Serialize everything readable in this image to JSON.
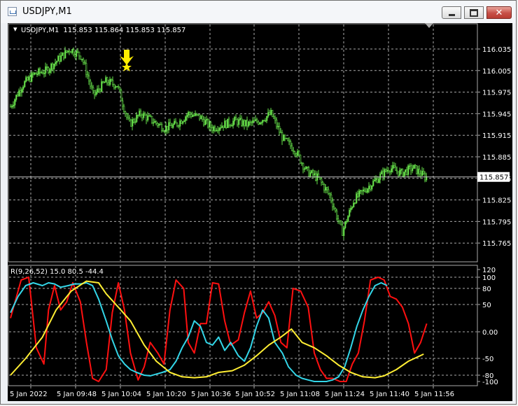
{
  "window": {
    "title": "USDJPY,M1",
    "icon": "chart-window-icon",
    "buttons": {
      "minimize": "minimize-icon",
      "maximize": "maximize-icon",
      "close": "close-icon"
    }
  },
  "colors": {
    "background": "#000000",
    "grid": "#aaaaaa",
    "candles": "#66e04a",
    "current_price_line": "#c0c0c0",
    "marker": "#ffee00",
    "rsi_like": "#ff1010",
    "cyan_line": "#33d6e8",
    "yellow_line": "#ffee33"
  },
  "chart_data": [
    {
      "type": "candlestick",
      "title": "USDJPY,M1",
      "ohlc_header": "115.853 115.864 115.853 115.857",
      "symbol_label": "USDJPY,M1",
      "ylim": [
        115.755,
        116.055
      ],
      "y_ticks": [
        "116.035",
        "116.005",
        "115.975",
        "115.945",
        "115.915",
        "115.885",
        "115.855",
        "115.825",
        "115.795",
        "115.765"
      ],
      "current_price": 115.857,
      "current_price_label": "115.857",
      "grid": true,
      "marker": {
        "type": "arrow-down-with-star",
        "x": "5 Jan 10:04",
        "price": 116.005
      },
      "close_trace": [
        [
          "5 Jan 2022",
          115.955
        ],
        [
          "5 Jan 09:38",
          115.985
        ],
        [
          "5 Jan 09:43",
          116.0
        ],
        [
          "5 Jan 09:46",
          116.005
        ],
        [
          "5 Jan 09:48",
          116.02
        ],
        [
          "5 Jan 09:52",
          116.035
        ],
        [
          "5 Jan 09:56",
          116.025
        ],
        [
          "5 Jan 10:00",
          115.97
        ],
        [
          "5 Jan 10:04",
          115.99
        ],
        [
          "5 Jan 10:06",
          115.985
        ],
        [
          "5 Jan 10:10",
          115.93
        ],
        [
          "5 Jan 10:14",
          115.945
        ],
        [
          "5 Jan 10:18",
          115.935
        ],
        [
          "5 Jan 10:22",
          115.925
        ],
        [
          "5 Jan 10:26",
          115.93
        ],
        [
          "5 Jan 10:30",
          115.945
        ],
        [
          "5 Jan 10:36",
          115.94
        ],
        [
          "5 Jan 10:40",
          115.925
        ],
        [
          "5 Jan 10:44",
          115.93
        ],
        [
          "5 Jan 10:50",
          115.935
        ],
        [
          "5 Jan 10:56",
          115.93
        ],
        [
          "5 Jan 11:00",
          115.935
        ],
        [
          "5 Jan 11:04",
          115.945
        ],
        [
          "5 Jan 11:08",
          115.91
        ],
        [
          "5 Jan 11:12",
          115.895
        ],
        [
          "5 Jan 11:16",
          115.865
        ],
        [
          "5 Jan 11:20",
          115.855
        ],
        [
          "5 Jan 11:24",
          115.83
        ],
        [
          "5 Jan 11:27",
          115.78
        ],
        [
          "5 Jan 11:30",
          115.825
        ],
        [
          "5 Jan 11:34",
          115.84
        ],
        [
          "5 Jan 11:38",
          115.855
        ],
        [
          "5 Jan 11:42",
          115.87
        ],
        [
          "5 Jan 11:46",
          115.862
        ],
        [
          "5 Jan 11:50",
          115.87
        ],
        [
          "5 Jan 11:52",
          115.857
        ]
      ]
    },
    {
      "type": "line",
      "title": "R(9,26,52) 15.0 80.5 -44.4",
      "ylim": [
        -110,
        120
      ],
      "y_ticks": [
        "120",
        "100",
        "80",
        "50",
        "0.00",
        "-50",
        "-80",
        "-100"
      ],
      "levels": [
        80,
        50,
        -50,
        -80
      ],
      "grid": true,
      "x_labels": [
        "5 Jan 2022",
        "5 Jan 09:48",
        "5 Jan 10:04",
        "5 Jan 10:20",
        "5 Jan 10:36",
        "5 Jan 10:52",
        "5 Jan 11:08",
        "5 Jan 11:24",
        "5 Jan 11:40",
        "5 Jan 11:56"
      ],
      "series": [
        {
          "color": "#ff1010",
          "points": [
            [
              0,
              25
            ],
            [
              7,
              95
            ],
            [
              12,
              100
            ],
            [
              17,
              -30
            ],
            [
              22,
              -60
            ],
            [
              25,
              40
            ],
            [
              29,
              85
            ],
            [
              33,
              40
            ],
            [
              37,
              55
            ],
            [
              41,
              90
            ],
            [
              46,
              55
            ],
            [
              50,
              -20
            ],
            [
              54,
              -90
            ],
            [
              58,
              -100
            ],
            [
              63,
              -70
            ],
            [
              67,
              35
            ],
            [
              71,
              90
            ],
            [
              75,
              40
            ],
            [
              79,
              -40
            ],
            [
              84,
              -95
            ],
            [
              88,
              -65
            ],
            [
              92,
              -20
            ],
            [
              97,
              -40
            ],
            [
              101,
              -60
            ],
            [
              105,
              40
            ],
            [
              109,
              95
            ],
            [
              114,
              80
            ],
            [
              117,
              -20
            ],
            [
              121,
              -40
            ],
            [
              125,
              15
            ],
            [
              129,
              15
            ],
            [
              133,
              90
            ],
            [
              137,
              88
            ],
            [
              141,
              20
            ],
            [
              145,
              -25
            ],
            [
              150,
              -15
            ],
            [
              154,
              35
            ],
            [
              158,
              75
            ],
            [
              162,
              25
            ],
            [
              166,
              35
            ],
            [
              170,
              55
            ],
            [
              174,
              30
            ],
            [
              178,
              -20
            ],
            [
              182,
              -30
            ],
            [
              186,
              80
            ],
            [
              191,
              75
            ],
            [
              196,
              45
            ],
            [
              200,
              -40
            ],
            [
              204,
              -70
            ],
            [
              208,
              -90
            ],
            [
              212,
              -90
            ],
            [
              217,
              -100
            ],
            [
              221,
              -100
            ],
            [
              225,
              -60
            ],
            [
              229,
              -40
            ],
            [
              233,
              20
            ],
            [
              237,
              95
            ],
            [
              242,
              100
            ],
            [
              246,
              95
            ],
            [
              250,
              65
            ],
            [
              254,
              60
            ],
            [
              258,
              45
            ],
            [
              262,
              15
            ],
            [
              266,
              -40
            ],
            [
              270,
              -20
            ],
            [
              274,
              15
            ]
          ]
        },
        {
          "color": "#33d6e8",
          "points": [
            [
              0,
              35
            ],
            [
              5,
              65
            ],
            [
              10,
              85
            ],
            [
              15,
              90
            ],
            [
              21,
              85
            ],
            [
              25,
              90
            ],
            [
              29,
              88
            ],
            [
              33,
              82
            ],
            [
              38,
              85
            ],
            [
              42,
              88
            ],
            [
              46,
              88
            ],
            [
              50,
              90
            ],
            [
              54,
              85
            ],
            [
              58,
              60
            ],
            [
              63,
              20
            ],
            [
              67,
              -15
            ],
            [
              71,
              -45
            ],
            [
              75,
              -60
            ],
            [
              79,
              -70
            ],
            [
              83,
              -75
            ],
            [
              88,
              -80
            ],
            [
              92,
              -82
            ],
            [
              96,
              -78
            ],
            [
              100,
              -75
            ],
            [
              105,
              -70
            ],
            [
              109,
              -55
            ],
            [
              113,
              -30
            ],
            [
              117,
              -10
            ],
            [
              121,
              20
            ],
            [
              125,
              10
            ],
            [
              129,
              -20
            ],
            [
              133,
              -25
            ],
            [
              137,
              -10
            ],
            [
              141,
              -35
            ],
            [
              145,
              -20
            ],
            [
              150,
              -45
            ],
            [
              154,
              -55
            ],
            [
              158,
              -30
            ],
            [
              162,
              10
            ],
            [
              166,
              40
            ],
            [
              170,
              25
            ],
            [
              174,
              -20
            ],
            [
              179,
              -40
            ],
            [
              183,
              -65
            ],
            [
              188,
              -80
            ],
            [
              192,
              -90
            ],
            [
              196,
              -95
            ],
            [
              200,
              -100
            ],
            [
              204,
              -100
            ],
            [
              208,
              -100
            ],
            [
              212,
              -95
            ],
            [
              216,
              -85
            ],
            [
              220,
              -65
            ],
            [
              224,
              -30
            ],
            [
              228,
              10
            ],
            [
              232,
              40
            ],
            [
              236,
              65
            ],
            [
              240,
              85
            ],
            [
              244,
              90
            ],
            [
              248,
              85
            ]
          ]
        },
        {
          "color": "#ffee33",
          "points": [
            [
              0,
              -80
            ],
            [
              10,
              -50
            ],
            [
              21,
              -10
            ],
            [
              30,
              40
            ],
            [
              40,
              75
            ],
            [
              50,
              93
            ],
            [
              58,
              90
            ],
            [
              63,
              70
            ],
            [
              71,
              45
            ],
            [
              79,
              20
            ],
            [
              88,
              -25
            ],
            [
              96,
              -55
            ],
            [
              105,
              -75
            ],
            [
              113,
              -85
            ],
            [
              121,
              -88
            ],
            [
              129,
              -85
            ],
            [
              137,
              -75
            ],
            [
              146,
              -72
            ],
            [
              154,
              -62
            ],
            [
              162,
              -45
            ],
            [
              170,
              -25
            ],
            [
              178,
              -10
            ],
            [
              185,
              5
            ],
            [
              192,
              -20
            ],
            [
              200,
              -30
            ],
            [
              208,
              -45
            ],
            [
              216,
              -62
            ],
            [
              224,
              -75
            ],
            [
              232,
              -85
            ],
            [
              240,
              -88
            ],
            [
              246,
              -82
            ],
            [
              254,
              -70
            ],
            [
              262,
              -55
            ],
            [
              272,
              -42
            ]
          ]
        }
      ]
    }
  ]
}
